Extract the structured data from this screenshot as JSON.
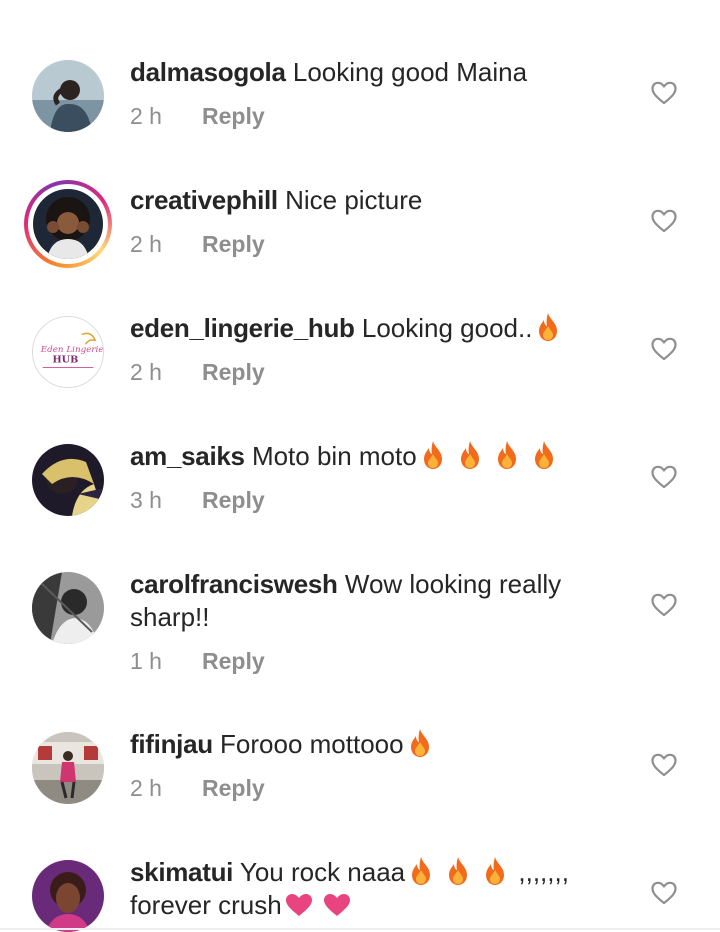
{
  "comments": [
    {
      "username": "dalmasogola",
      "text": "Looking good Maina",
      "time": "2 h",
      "reply": "Reply"
    },
    {
      "username": "creativephill",
      "text": "Nice picture",
      "time": "2 h",
      "reply": "Reply"
    },
    {
      "username": "eden_lingerie_hub",
      "text": "Looking good..",
      "time": "2 h",
      "reply": "Reply",
      "avatar_logo": {
        "line1": "Eden Lingerie",
        "line2": "HUB"
      }
    },
    {
      "username": "am_saiks",
      "text": "Moto bin moto",
      "time": "3 h",
      "reply": "Reply"
    },
    {
      "username": "carolfranciswesh",
      "text": "Wow looking really sharp!!",
      "time": "1 h",
      "reply": "Reply"
    },
    {
      "username": "fifinjau",
      "text": "Forooo mottooo",
      "time": "2 h",
      "reply": "Reply"
    },
    {
      "username": "skimatui",
      "text_part1": "You rock naaa",
      "text_part2": ",,,,,,, forever crush"
    }
  ],
  "icons": {
    "like": "heart-outline-icon",
    "fire": "fire-emoji",
    "pink_heart": "pink-heart-emoji"
  },
  "colors": {
    "username": "#262626",
    "meta": "#8e8e8e",
    "heart_outline": "#8e8e8e",
    "pink_heart": "#e8447f"
  }
}
